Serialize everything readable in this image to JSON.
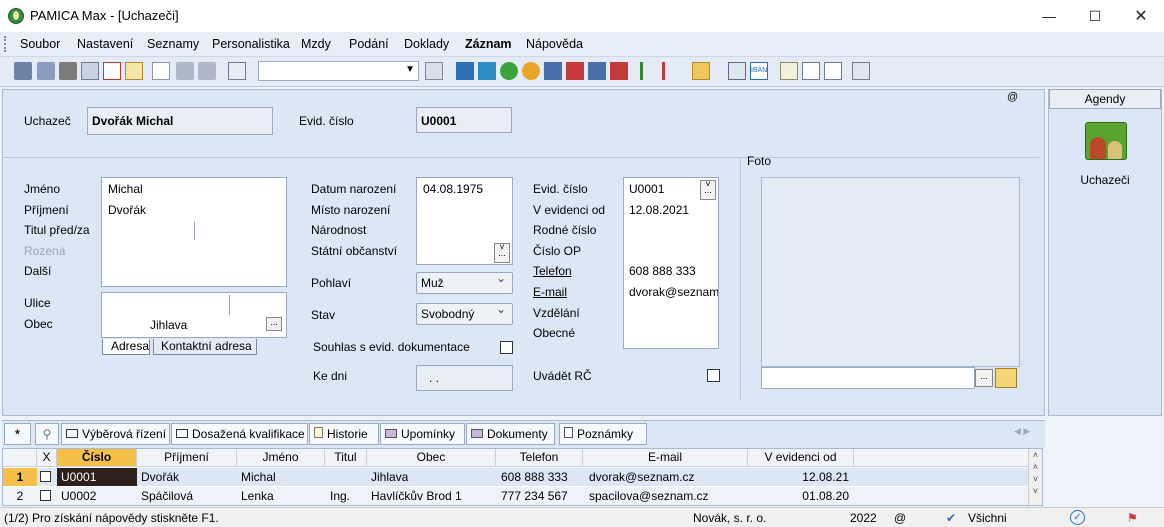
{
  "window": {
    "title": "PAMICA Max - [Uchazeči]"
  },
  "menu": [
    "Soubor",
    "Nastavení",
    "Seznamy",
    "Personalistika",
    "Mzdy",
    "Podání",
    "Doklady",
    "Záznam",
    "Nápověda"
  ],
  "header": {
    "applicant_label": "Uchazeč",
    "applicant_value": "Dvořák Michal",
    "evid_label": "Evid. číslo",
    "evid_value": "U0001",
    "at_sign": "@"
  },
  "personal": {
    "labels": [
      "Jméno",
      "Příjmení",
      "Titul před/za",
      "Rozená",
      "Další"
    ],
    "values": [
      "Michal",
      "Dvořák"
    ]
  },
  "address": {
    "street_label": "Ulice",
    "city_label": "Obec",
    "city_value": "Jihlava",
    "tabs": [
      "Adresa",
      "Kontaktní adresa"
    ]
  },
  "birth": {
    "labels": [
      "Datum narození",
      "Místo narození",
      "Národnost",
      "Státní občanství"
    ],
    "date_value": "04.08.1975"
  },
  "gender": {
    "label": "Pohlaví",
    "value": "Muž"
  },
  "status": {
    "label": "Stav",
    "value": "Svobodný"
  },
  "consent": {
    "label": "Souhlas s evid. dokumentace"
  },
  "asof": {
    "label": "Ke dni",
    "value": ". ."
  },
  "record": {
    "labels": [
      "Evid. číslo",
      "V evidenci od",
      "Rodné číslo",
      "Číslo OP",
      "Telefon",
      "E-mail",
      "Vzdělání",
      "Obecné"
    ],
    "evid": "U0001",
    "since": "12.08.2021",
    "phone": "608 888 333",
    "email": "dvorak@seznam"
  },
  "show_rc": {
    "label": "Uvádět RČ"
  },
  "photo": {
    "label": "Foto"
  },
  "agendy": {
    "header": "Agendy",
    "item": "Uchazeči"
  },
  "tabs": [
    "Výběrová řízení",
    "Dosažená kvalifikace",
    "Historie",
    "Upomínky",
    "Dokumenty",
    "Poznámky"
  ],
  "grid": {
    "columns": [
      "X",
      "Číslo",
      "Příjmení",
      "Jméno",
      "Titul",
      "Obec",
      "Telefon",
      "E-mail",
      "V evidenci od"
    ],
    "rows": [
      {
        "n": "1",
        "cislo": "U0001",
        "prijmeni": "Dvořák",
        "jmeno": "Michal",
        "titul": "",
        "obec": "Jihlava",
        "telefon": "608 888 333",
        "email": "dvorak@seznam.cz",
        "od": "12.08.21"
      },
      {
        "n": "2",
        "cislo": "U0002",
        "prijmeni": "Spáčilová",
        "jmeno": "Lenka",
        "titul": "Ing.",
        "obec": "Havlíčkův Brod 1",
        "telefon": "777 234 567",
        "email": "spacilova@seznam.cz",
        "od": "01.08.20"
      }
    ]
  },
  "statusbar": {
    "help": "(1/2) Pro získání nápovědy stiskněte F1.",
    "company": "Novák, s. r. o.",
    "year": "2022",
    "at": "@",
    "filter": "Všichni"
  }
}
